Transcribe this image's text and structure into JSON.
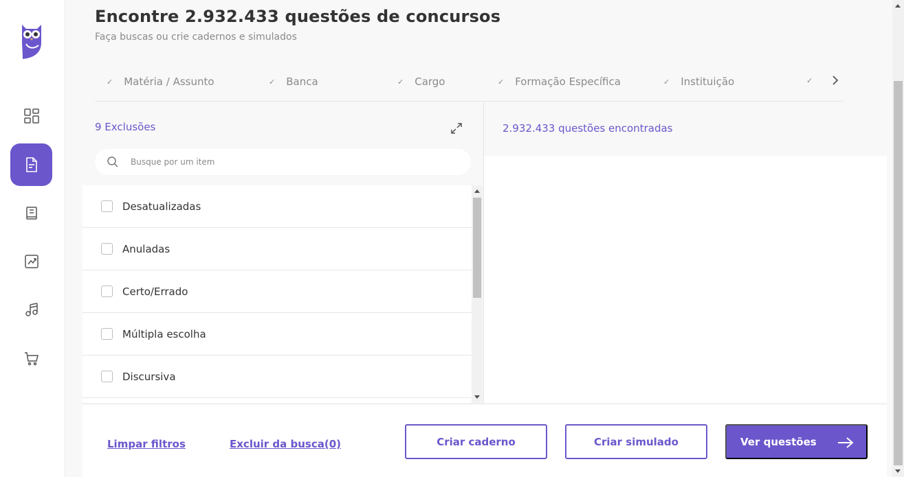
{
  "header": {
    "title": "Encontre 2.932.433 questões de concursos",
    "subtitle": "Faça buscas ou crie cadernos e simulados"
  },
  "sidebar": {
    "items": [
      {
        "icon": "dashboard-icon"
      },
      {
        "icon": "document-icon",
        "active": true
      },
      {
        "icon": "book-icon"
      },
      {
        "icon": "chart-icon"
      },
      {
        "icon": "music-icon"
      },
      {
        "icon": "cart-icon"
      }
    ]
  },
  "filters": {
    "tabs": [
      {
        "label": "Matéria / Assunto"
      },
      {
        "label": "Banca"
      },
      {
        "label": "Cargo"
      },
      {
        "label": "Formação Específica"
      },
      {
        "label": "Instituição"
      },
      {
        "label": ""
      }
    ]
  },
  "exclusions": {
    "heading": "9 Exclusões",
    "search_placeholder": "Busque por um item",
    "items": [
      {
        "label": "Desatualizadas",
        "checked": false
      },
      {
        "label": "Anuladas",
        "checked": false
      },
      {
        "label": "Certo/Errado",
        "checked": false
      },
      {
        "label": "Múltipla escolha",
        "checked": false
      },
      {
        "label": "Discursiva",
        "checked": false
      }
    ]
  },
  "results": {
    "count_text": "2.932.433 questões encontradas"
  },
  "actions": {
    "clear_filters": "Limpar filtros",
    "exclude_search": "Excluir da busca(0)",
    "create_notebook": "Criar caderno",
    "create_mock": "Criar simulado",
    "view_questions": "Ver questões"
  },
  "colors": {
    "accent": "#6b56cc"
  }
}
